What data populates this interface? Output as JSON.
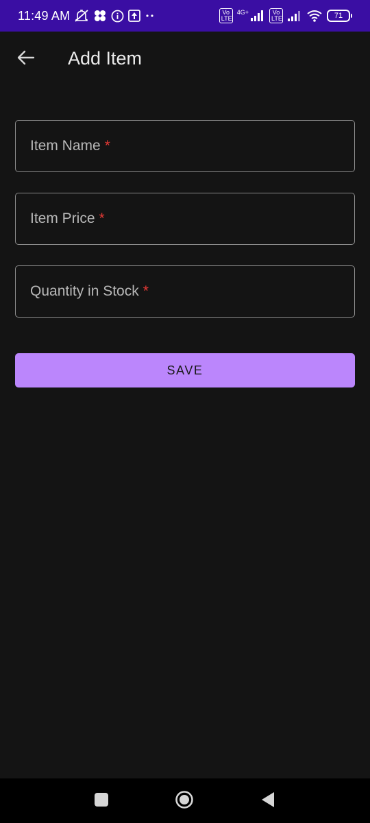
{
  "status_bar": {
    "time": "11:49 AM",
    "network_type": "4G+",
    "volte_1": "Vo LTE",
    "volte_2": "Vo LTE",
    "battery": "71",
    "colors": {
      "background": "#3a0ea3",
      "foreground": "#ffffff"
    }
  },
  "app_bar": {
    "title": "Add Item",
    "back_icon": "arrow-back-icon"
  },
  "form": {
    "fields": [
      {
        "label": "Item Name",
        "required_mark": "*",
        "value": ""
      },
      {
        "label": "Item Price",
        "required_mark": "*",
        "value": ""
      },
      {
        "label": "Quantity in Stock",
        "required_mark": "*",
        "value": ""
      }
    ],
    "save_label": "SAVE"
  },
  "nav_bar": {
    "icons": [
      "recent-apps-icon",
      "home-icon",
      "back-icon"
    ]
  },
  "colors": {
    "background": "#141414",
    "field_border": "#8b8b8b",
    "label": "#b8b8b8",
    "required": "#e53935",
    "accent": "#bb86fc",
    "nav_background": "#000000"
  }
}
